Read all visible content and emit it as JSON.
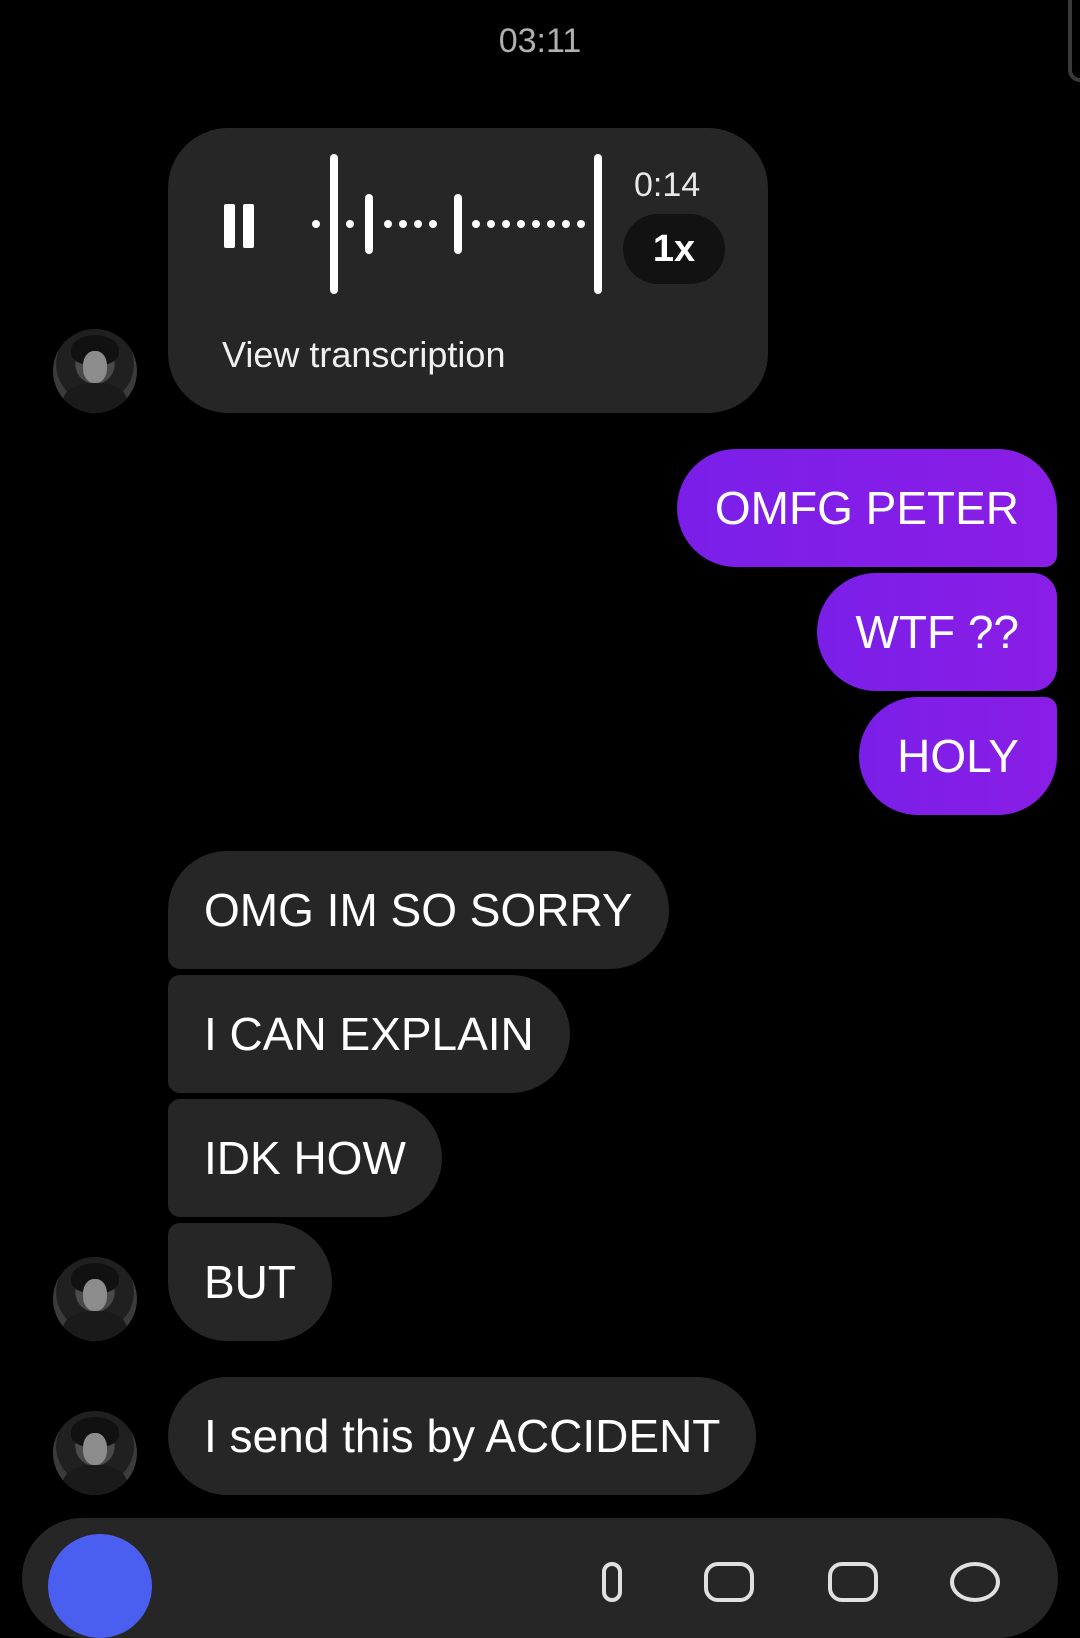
{
  "header": {
    "time": "03:11"
  },
  "voice_message": {
    "duration": "0:14",
    "speed": "1x",
    "transcription_label": "View transcription",
    "state_icon": "pause-icon"
  },
  "messages": [
    {
      "direction": "outgoing",
      "text": "OMFG PETER"
    },
    {
      "direction": "outgoing",
      "text": "WTF ??"
    },
    {
      "direction": "outgoing",
      "text": "HOLY"
    },
    {
      "direction": "incoming",
      "text": "OMG IM SO SORRY"
    },
    {
      "direction": "incoming",
      "text": "I CAN EXPLAIN"
    },
    {
      "direction": "incoming",
      "text": "IDK HOW"
    },
    {
      "direction": "incoming",
      "text": "BUT"
    },
    {
      "direction": "incoming",
      "text": "I send this by ACCIDENT"
    }
  ],
  "colors": {
    "background": "#000000",
    "incoming_bubble": "#262626",
    "outgoing_bubble": "#7a1fe8",
    "camera_button": "#4a5ff0"
  },
  "composer": {
    "icons": [
      "camera-icon",
      "microphone-icon",
      "gallery-icon",
      "sticker-icon",
      "smile-icon"
    ]
  }
}
